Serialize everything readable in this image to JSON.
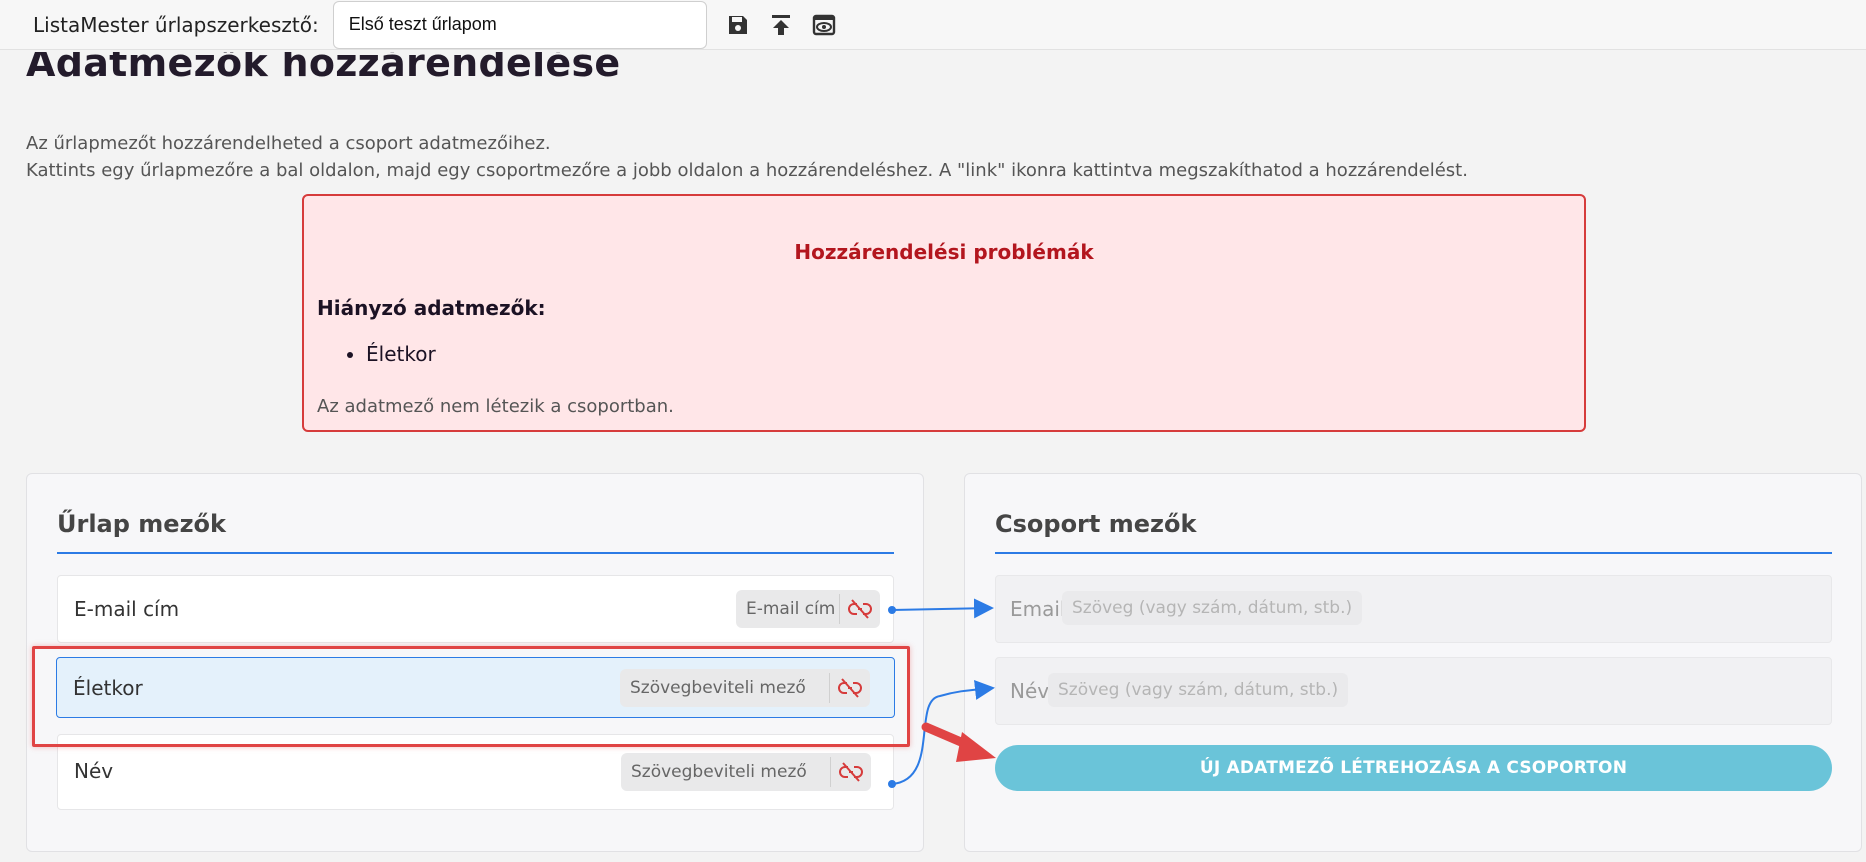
{
  "toolbar": {
    "app_label": "ListaMester űrlapszerkesztő:",
    "form_title_value": "Első teszt űrlapom",
    "icons": [
      "save-icon",
      "upload-icon",
      "preview-eye-icon"
    ]
  },
  "page": {
    "heading": "Adatmezők hozzárendelése",
    "intro_line1": "Az űrlapmezőt hozzárendelheted a csoport adatmezőihez.",
    "intro_line2": "Kattints egy űrlapmezőre a bal oldalon, majd egy csoportmezőre a jobb oldalon a hozzárendeléshez. A \"link\" ikonra kattintva megszakíthatod a hozzárendelést."
  },
  "error": {
    "title": "Hozzárendelési problémák",
    "subtitle": "Hiányzó adatmezők:",
    "missing": [
      "Életkor"
    ],
    "note": "Az adatmező nem létezik a csoportban."
  },
  "form_fields": {
    "title": "Űrlap mezők",
    "rows": [
      {
        "label": "E-mail cím",
        "type": "E-mail cím"
      },
      {
        "label": "Életkor",
        "type": "Szövegbeviteli mező"
      },
      {
        "label": "Név",
        "type": "Szövegbeviteli mező"
      }
    ]
  },
  "group_fields": {
    "title": "Csoport mezők",
    "rows": [
      {
        "label": "Email",
        "type": "Szöveg (vagy szám, dátum, stb.)"
      },
      {
        "label": "Név",
        "type": "Szöveg (vagy szám, dátum, stb.)"
      }
    ],
    "create_button": "ÚJ ADATMEZŐ LÉTREHOZÁSA A CSOPORTON"
  },
  "colors": {
    "accent": "#2c7be5",
    "error": "#d63b3b",
    "button": "#6ac4d9",
    "annotation": "#e04444"
  }
}
